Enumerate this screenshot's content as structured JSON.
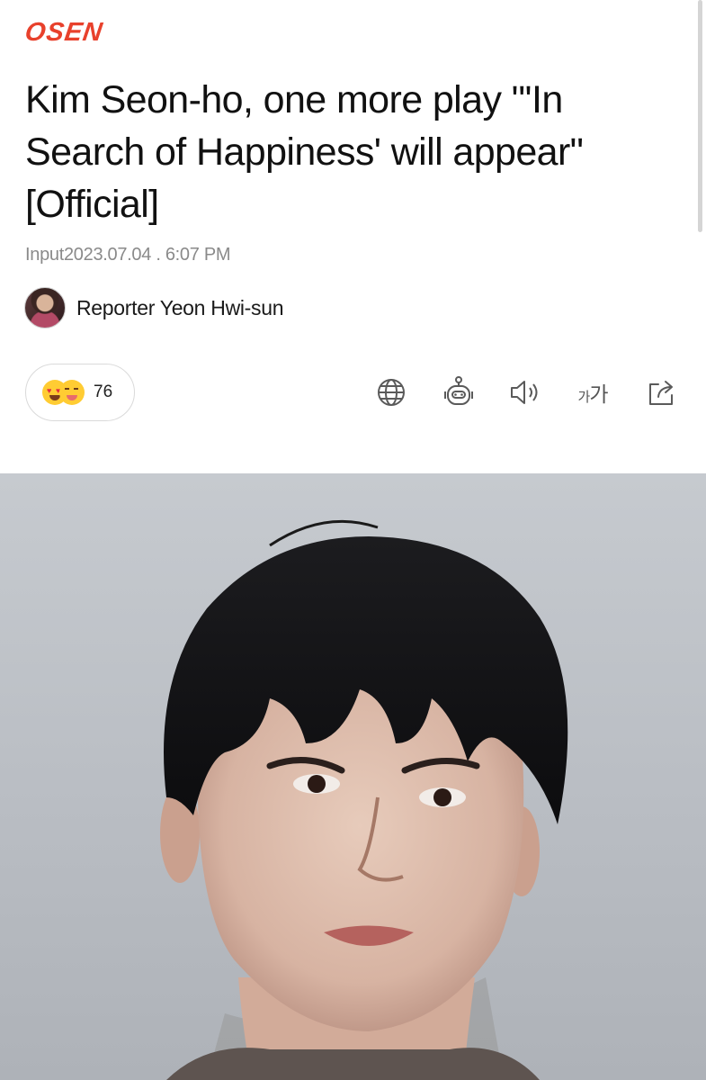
{
  "header": {
    "logo_text": "OSEN",
    "brand_color": "#e8412c"
  },
  "article": {
    "title": "Kim Seon-ho, one more play \"'In Search of Happiness' will appear\" [Official]",
    "input_label": "Input",
    "input_date": "2023.07.04 . 6:07 PM",
    "reporter": "Reporter Yeon Hwi-sun"
  },
  "reactions": {
    "emojis": [
      "heart-eyes-emoji",
      "winking-tongue-emoji"
    ],
    "count": "76"
  },
  "toolbar": {
    "icons": [
      "globe-icon",
      "robot-icon",
      "speaker-icon",
      "font-size-icon",
      "share-icon"
    ],
    "font_size_small": "가",
    "font_size_large": "가"
  },
  "photo": {
    "subject": "portrait-photo",
    "background_color": "#bec2c8"
  }
}
